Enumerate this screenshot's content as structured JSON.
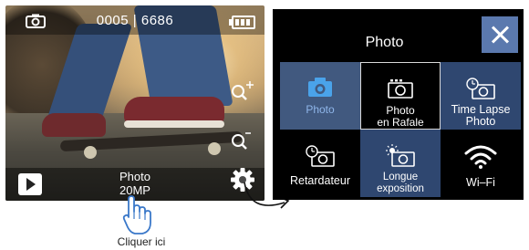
{
  "camera_view": {
    "counter": "0005 | 6686",
    "mode_line1": "Photo",
    "mode_line2": "20MP"
  },
  "hint": {
    "text": "Cliquer ici"
  },
  "menu": {
    "title": "Photo",
    "close_glyph": "close-icon",
    "items": [
      {
        "label_line1": "Photo",
        "label_line2": "",
        "icon": "camera-icon"
      },
      {
        "label_line1": "Photo",
        "label_line2": "en Rafale",
        "icon": "burst-camera-icon"
      },
      {
        "label_line1": "Time Lapse",
        "label_line2": "Photo",
        "icon": "timelapse-camera-icon"
      },
      {
        "label_line1": "Retardateur",
        "label_line2": "",
        "icon": "self-timer-camera-icon"
      },
      {
        "label_line1": "Longue",
        "label_line2": "exposition",
        "icon": "long-exposure-camera-icon"
      },
      {
        "label_line1": "Wi–Fi",
        "label_line2": "",
        "icon": "wifi-icon"
      }
    ]
  },
  "colors": {
    "selected_bg": "#41597f",
    "selected_text": "#8fb6ea",
    "close_bg": "#5b79ae",
    "hint_hand": "#3a78c9"
  }
}
